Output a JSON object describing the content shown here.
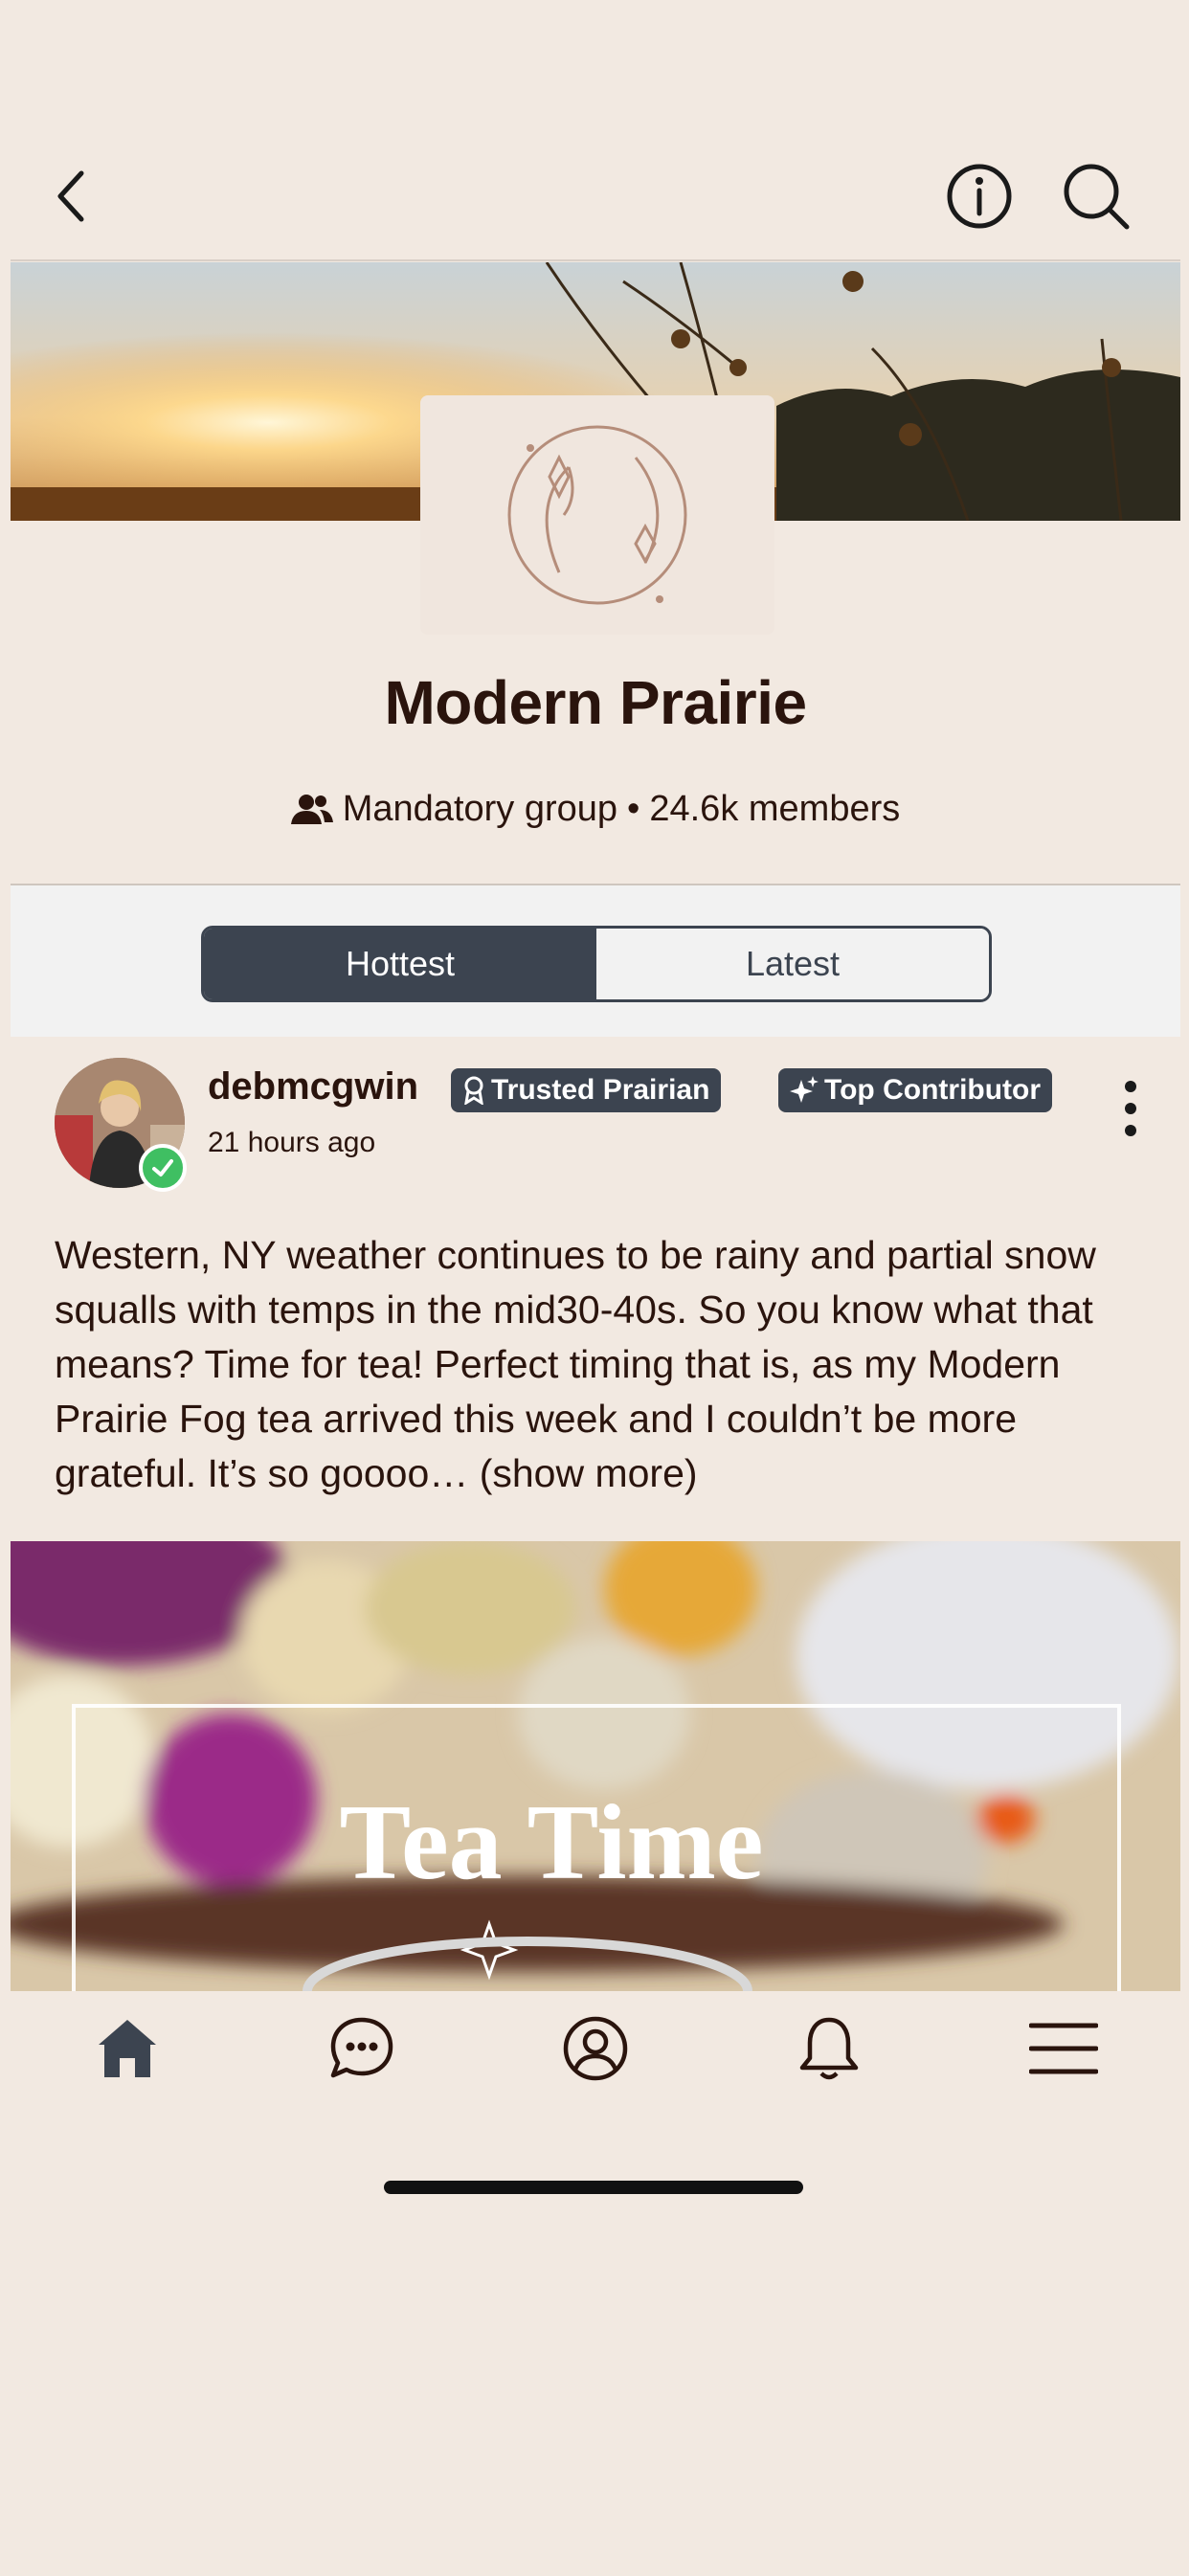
{
  "topbar": {
    "back_icon": "chevron-left-icon",
    "info_icon": "info-icon",
    "search_icon": "search-icon"
  },
  "group": {
    "title": "Modern Prairie",
    "meta_type": "Mandatory group",
    "meta_sep": "•",
    "meta_members": "24.6k members"
  },
  "tabs": {
    "items": [
      {
        "label": "Hottest",
        "active": true
      },
      {
        "label": "Latest",
        "active": false
      }
    ]
  },
  "post": {
    "username": "debmcgwin",
    "badges": [
      {
        "label": "Trusted Prairian",
        "icon": "ribbon-icon"
      },
      {
        "label": "Top Contributor",
        "icon": "sparkle-icon"
      }
    ],
    "timestamp": "21 hours ago",
    "text": "Western, NY weather continues to be rainy and partial snow squalls with temps in the mid30-40s. So you know what that means? Time for tea! Perfect timing that is, as my Modern Prairie Fog tea arrived this week and I couldn’t be more grateful. It’s so goooo…",
    "show_more": "(show more)",
    "image_text": "Tea Time"
  },
  "bottom_nav": [
    "home-icon",
    "chat-icon",
    "profile-icon",
    "bell-icon",
    "menu-icon"
  ],
  "colors": {
    "background": "#f2e9e1",
    "accent": "#3c4450",
    "text": "#2a140d",
    "verified": "#3fbf62"
  }
}
